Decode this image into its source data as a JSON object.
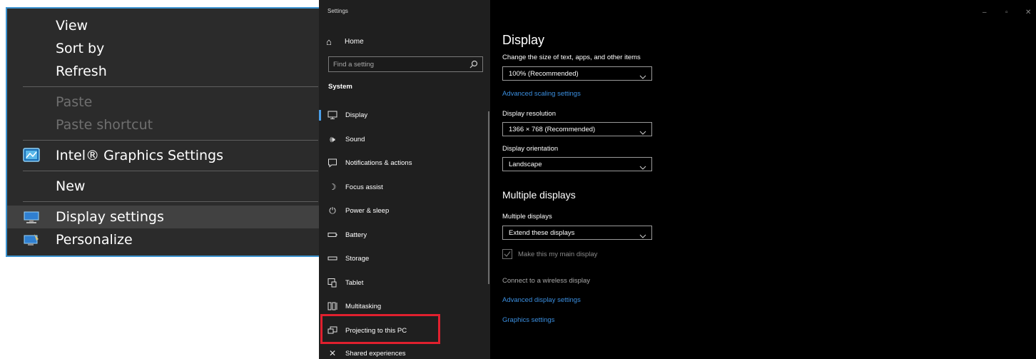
{
  "context_menu": {
    "items": {
      "view": "View",
      "sort_by": "Sort by",
      "refresh": "Refresh",
      "paste": "Paste",
      "paste_shortcut": "Paste shortcut",
      "intel": "Intel® Graphics Settings",
      "new": "New",
      "display_settings": "Display settings",
      "personalize": "Personalize"
    }
  },
  "settings": {
    "window_title": "Settings",
    "home": "Home",
    "search_placeholder": "Find a setting",
    "section": "System",
    "nav": [
      {
        "label": "Display",
        "icon": "monitor-icon"
      },
      {
        "label": "Sound",
        "icon": "speaker-icon"
      },
      {
        "label": "Notifications & actions",
        "icon": "notification-icon"
      },
      {
        "label": "Focus assist",
        "icon": "moon-icon"
      },
      {
        "label": "Power & sleep",
        "icon": "power-icon"
      },
      {
        "label": "Battery",
        "icon": "battery-icon"
      },
      {
        "label": "Storage",
        "icon": "storage-icon"
      },
      {
        "label": "Tablet",
        "icon": "tablet-icon"
      },
      {
        "label": "Multitasking",
        "icon": "multitasking-icon"
      },
      {
        "label": "Projecting to this PC",
        "icon": "projecting-icon"
      },
      {
        "label": "Shared experiences",
        "icon": "shared-experiences-icon"
      }
    ],
    "page_title": "Display",
    "scale_label": "Change the size of text, apps, and other items",
    "scale_value": "100% (Recommended)",
    "advanced_scaling": "Advanced scaling settings",
    "resolution_label": "Display resolution",
    "resolution_value": "1366 × 768 (Recommended)",
    "orientation_label": "Display orientation",
    "orientation_value": "Landscape",
    "multiple_heading": "Multiple displays",
    "multiple_label": "Multiple displays",
    "multiple_value": "Extend these displays",
    "main_display": "Make this my main display",
    "wireless": "Connect to a wireless display",
    "advanced_display": "Advanced display settings",
    "graphics": "Graphics settings"
  },
  "colors": {
    "accent": "#3b8fe0",
    "menu_border": "#3c93d0",
    "highlight_box": "#e0202e"
  }
}
